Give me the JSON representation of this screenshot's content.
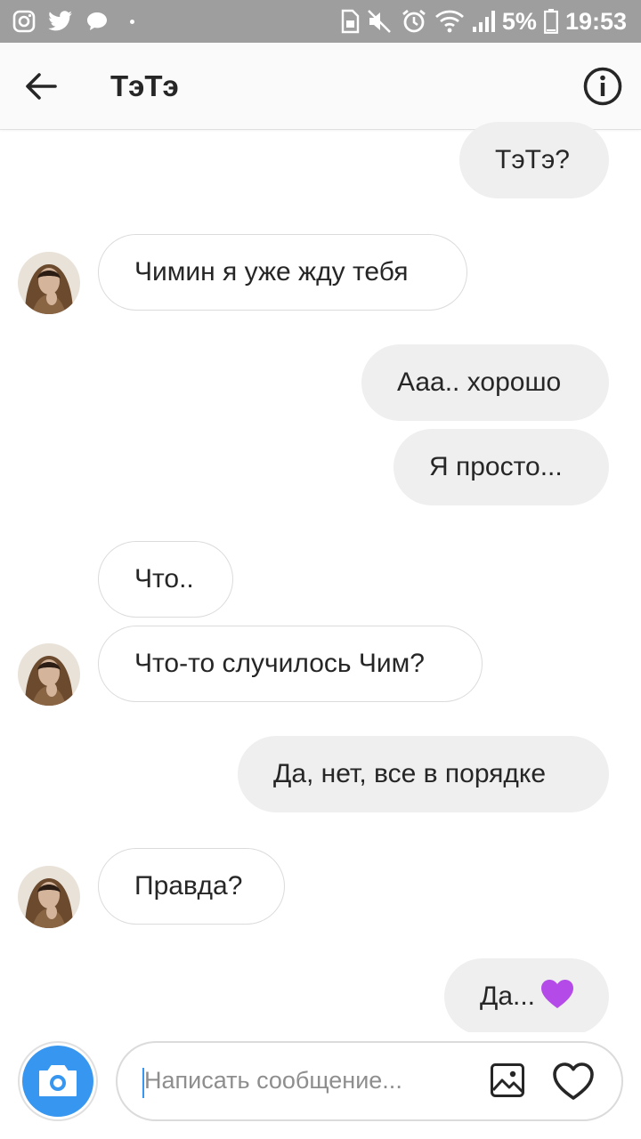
{
  "status_bar": {
    "battery": "5%",
    "time": "19:53"
  },
  "header": {
    "title": "ТэТэ"
  },
  "messages": [
    {
      "text": "ТэТэ?",
      "direction": "outgoing"
    },
    {
      "text": "Чимин я уже жду тебя",
      "direction": "incoming"
    },
    {
      "text": "Ааа.. хорошо",
      "direction": "outgoing"
    },
    {
      "text": "Я просто...",
      "direction": "outgoing"
    },
    {
      "text": "Что..",
      "direction": "incoming"
    },
    {
      "text": "Что-то случилось Чим?",
      "direction": "incoming"
    },
    {
      "text": "Да, нет, все в порядке",
      "direction": "outgoing"
    },
    {
      "text": "Правда?",
      "direction": "incoming"
    },
    {
      "text": "Да...",
      "direction": "outgoing",
      "emoji": "purple-heart"
    }
  ],
  "composer": {
    "placeholder": "Написать сообщение..."
  },
  "colors": {
    "status_bar": "#9e9e9e",
    "outgoing_bubble": "#efefef",
    "incoming_border": "#dbdbdb",
    "camera_button": "#3797f0",
    "purple_heart": "#b44be8"
  }
}
